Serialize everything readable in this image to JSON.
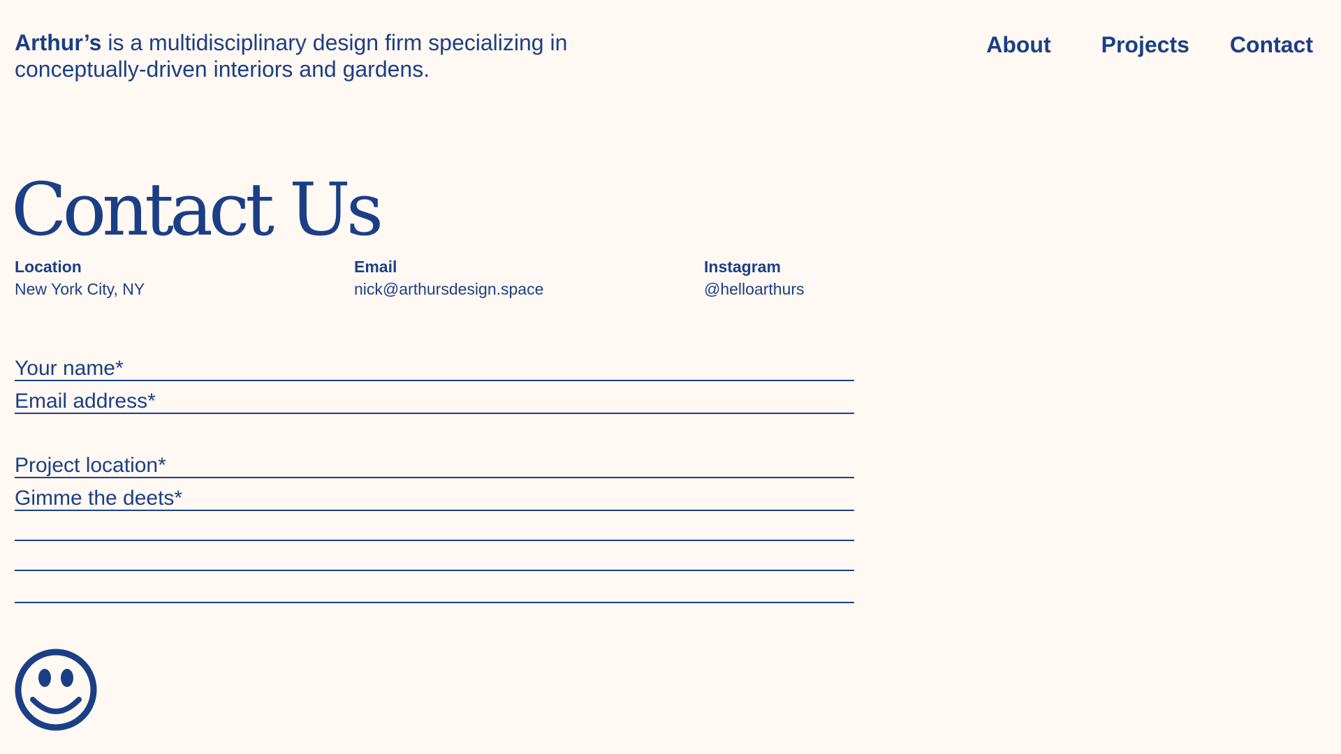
{
  "header": {
    "brand": "Arthur’s",
    "tagline": " is a multidisciplinary design firm specializing in conceptually-driven interiors and gardens.",
    "nav": [
      {
        "label": "About"
      },
      {
        "label": "Projects"
      },
      {
        "label": "Contact"
      }
    ]
  },
  "main": {
    "title": "Contact Us",
    "info": {
      "location": {
        "label": "Location",
        "value": "New York City, NY"
      },
      "email": {
        "label": "Email",
        "value": "nick@arthursdesign.space"
      },
      "instagram": {
        "label": "Instagram",
        "value": "@helloarthurs"
      }
    },
    "form": {
      "name_placeholder": "Your name*",
      "email_placeholder": "Email address*",
      "location_placeholder": "Project location*",
      "details_placeholder": "Gimme the deets*"
    }
  },
  "icons": {
    "footer_icon": "smiley-face-icon"
  },
  "colors": {
    "background": "#fff8f3",
    "accent": "#1b3f85"
  }
}
